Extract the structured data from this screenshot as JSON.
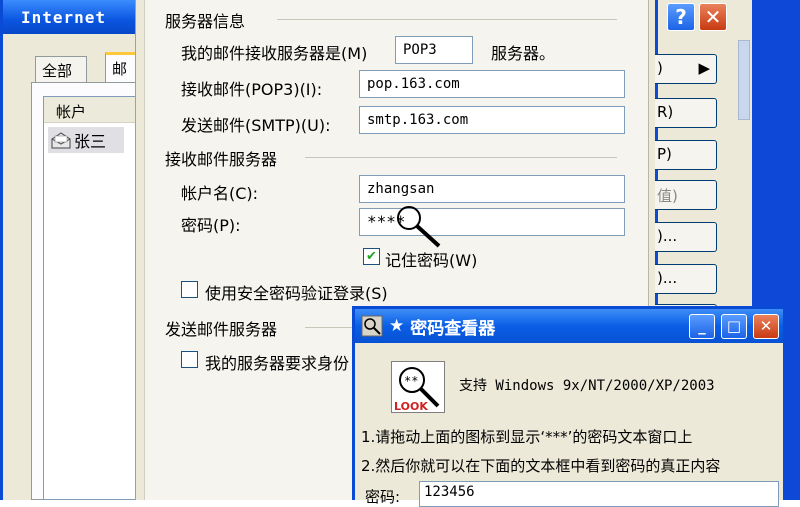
{
  "accounts_window": {
    "title": "Internet",
    "tabs": [
      "全部",
      "邮"
    ],
    "list_header": "帐户",
    "accounts": [
      {
        "name": "张三"
      }
    ]
  },
  "server_dialog": {
    "server_info_group": "服务器信息",
    "incoming_type_label_pre": "我的邮件接收服务器是",
    "incoming_type_key": "(M)",
    "incoming_type_value": "POP3",
    "incoming_type_suffix": "服务器。",
    "pop3_label": "接收邮件(POP3)",
    "pop3_key": "(I)",
    "pop3_value": "pop.163.com",
    "smtp_label": "发送邮件(SMTP)",
    "smtp_key": "(U)",
    "smtp_value": "smtp.163.com",
    "incoming_group": "接收邮件服务器",
    "account_label": "帐户名",
    "account_key": "(C)",
    "account_value": "zhangsan",
    "password_label": "密码",
    "password_key": "(P)",
    "password_value": "****",
    "remember_label": "记住密码",
    "remember_key": "(W)",
    "remember_checked": true,
    "spa_label": "使用安全密码验证登录",
    "spa_key": "(S)",
    "spa_checked": false,
    "outgoing_group": "发送邮件服务器",
    "auth_label": "我的服务器要求身份",
    "auth_checked": false
  },
  "right_column": {
    "help": "?",
    "close": "✕",
    "buttons": [
      "",
      "R)",
      "P)",
      "值)",
      ")...",
      ")...",
      ")..."
    ]
  },
  "password_viewer": {
    "title": "密码查看器",
    "support_text": "支持 Windows 9x/NT/2000/XP/2003",
    "instruction1": "1.请拖动上面的图标到显示‘***’的密码文本窗口上",
    "instruction2": "2.然后你就可以在下面的文本框中看到密码的真正内容",
    "password_label": "密码:",
    "revealed_password": "123456",
    "icon_text": "LOOK"
  },
  "colors": {
    "xp_blue": "#0a4bd6",
    "dialog_bg": "#ece9d8",
    "checkmark_green": "#21a121",
    "close_red": "#c83a12"
  }
}
